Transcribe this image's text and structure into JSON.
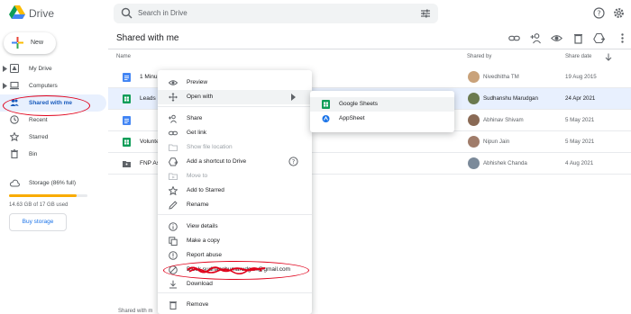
{
  "app": {
    "name": "Drive"
  },
  "search": {
    "placeholder": "Search in Drive"
  },
  "sidebar": {
    "new_label": "New",
    "items": [
      {
        "label": "My Drive"
      },
      {
        "label": "Computers"
      },
      {
        "label": "Shared with me",
        "active": true
      },
      {
        "label": "Recent"
      },
      {
        "label": "Starred"
      },
      {
        "label": "Bin"
      }
    ],
    "storage": {
      "label": "Storage (86% full)",
      "usage": "14.63 GB of 17 GB used",
      "fill_fraction": 0.86,
      "buy_label": "Buy storage"
    }
  },
  "main": {
    "title": "Shared with me",
    "columns": {
      "name": "Name",
      "shared_by": "Shared by",
      "share_date": "Share date"
    },
    "rows": [
      {
        "name": "1 Minu",
        "type": "doc",
        "shared_by": "Nivedhitha TM",
        "date": "19 Aug 2015"
      },
      {
        "name": "Leads",
        "type": "sheet",
        "shared_by": "Sudhanshu Marudgan",
        "date": "24 Apr 2021",
        "selected": true
      },
      {
        "name": "",
        "type": "doc",
        "shared_by": "Abhinav Shivam",
        "date": "5 May 2021"
      },
      {
        "name": "Volunte",
        "type": "sheet",
        "shared_by": "Nipun Jain",
        "date": "5 May 2021"
      },
      {
        "name": "FNP As",
        "type": "folder",
        "shared_by": "Abhishek Chanda",
        "date": "4 Aug 2021"
      }
    ],
    "bottom_hint": "Shared with m"
  },
  "context_menu": {
    "items": [
      {
        "label": "Preview",
        "icon": "eye-icon"
      },
      {
        "label": "Open with",
        "icon": "move-icon",
        "has_submenu": true,
        "highlighted": true
      },
      {
        "label": "Share",
        "icon": "person-add-icon"
      },
      {
        "label": "Get link",
        "icon": "link-icon"
      },
      {
        "label": "Show file location",
        "icon": "folder-icon",
        "disabled": true
      },
      {
        "label": "Add a shortcut to Drive",
        "icon": "shortcut-icon",
        "help": true
      },
      {
        "label": "Move to",
        "icon": "move-to-icon",
        "disabled": true
      },
      {
        "label": "Add to Starred",
        "icon": "star-icon"
      },
      {
        "label": "Rename",
        "icon": "pencil-icon"
      },
      {
        "label": "View details",
        "icon": "info-icon"
      },
      {
        "label": "Make a copy",
        "icon": "copy-icon"
      },
      {
        "label": "Report abuse",
        "icon": "report-icon"
      },
      {
        "label": "Block sudhanshumarudgan@gmail.com",
        "icon": "block-icon"
      },
      {
        "label": "Download",
        "icon": "download-icon"
      },
      {
        "label": "Remove",
        "icon": "trash-icon"
      }
    ]
  },
  "submenu": {
    "items": [
      {
        "label": "Google Sheets",
        "icon": "sheets-icon"
      },
      {
        "label": "AppSheet",
        "icon": "appsheet-icon"
      }
    ]
  },
  "colors": {
    "accent": "#1a73e8",
    "active_bg": "#e8f0fe",
    "annotation": "#e0001a",
    "sheets_green": "#0f9d58",
    "docs_blue": "#4285f4"
  }
}
